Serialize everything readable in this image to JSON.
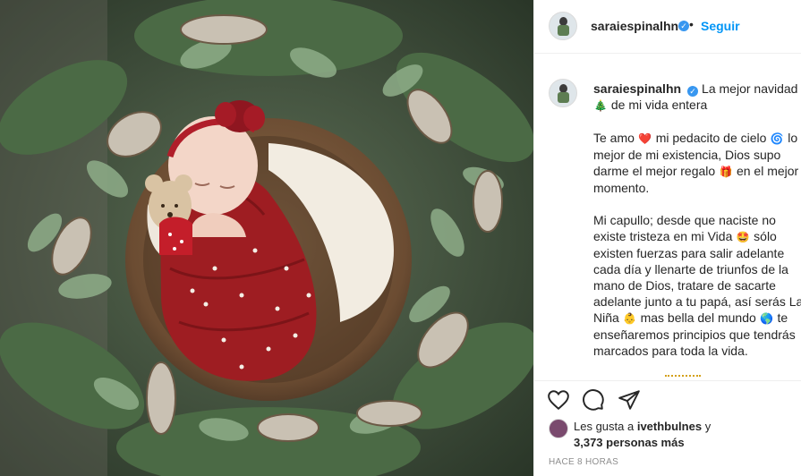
{
  "post": {
    "username": "saraiespinalhn",
    "verified": true,
    "follow_label": "Seguir",
    "separator": "•",
    "caption": {
      "username": "saraiespinalhn",
      "paragraphs": [
        [
          {
            "t": "La mejor navidad "
          },
          {
            "emoji": "🎄"
          },
          {
            "t": " de mi vida entera"
          }
        ],
        [
          {
            "t": "Te amo "
          },
          {
            "emoji": "❤️"
          },
          {
            "t": " mi pedacito de cielo "
          },
          {
            "emoji": "🌀"
          },
          {
            "t": " lo mejor de mi existencia, Dios supo darme el mejor regalo "
          },
          {
            "emoji": "🎁"
          },
          {
            "t": " en el mejor momento."
          }
        ],
        [
          {
            "t": "Mi capullo; desde que naciste no existe tristeza en mi Vida "
          },
          {
            "emoji": "🤩"
          },
          {
            "t": " sólo existen fuerzas para salir adelante cada día y llenarte de triunfos de la mano de Dios, tratare de sacarte adelante junto a tu papá, así serás La Niña "
          },
          {
            "emoji": "👶"
          },
          {
            "t": " mas bella del mundo "
          },
          {
            "emoji": "🌎"
          },
          {
            "t": " te enseñaremos principios que tendrás marcados para toda la vida."
          }
        ]
      ]
    },
    "likes": {
      "prefix": "Les gusta a ",
      "user": "ivethbulnes",
      "suffix": " y",
      "count_text": "3,373 personas más"
    },
    "timestamp": "HACE 8 HORAS",
    "icons": {
      "like": "heart-icon",
      "comment": "comment-icon",
      "share": "share-icon"
    }
  }
}
